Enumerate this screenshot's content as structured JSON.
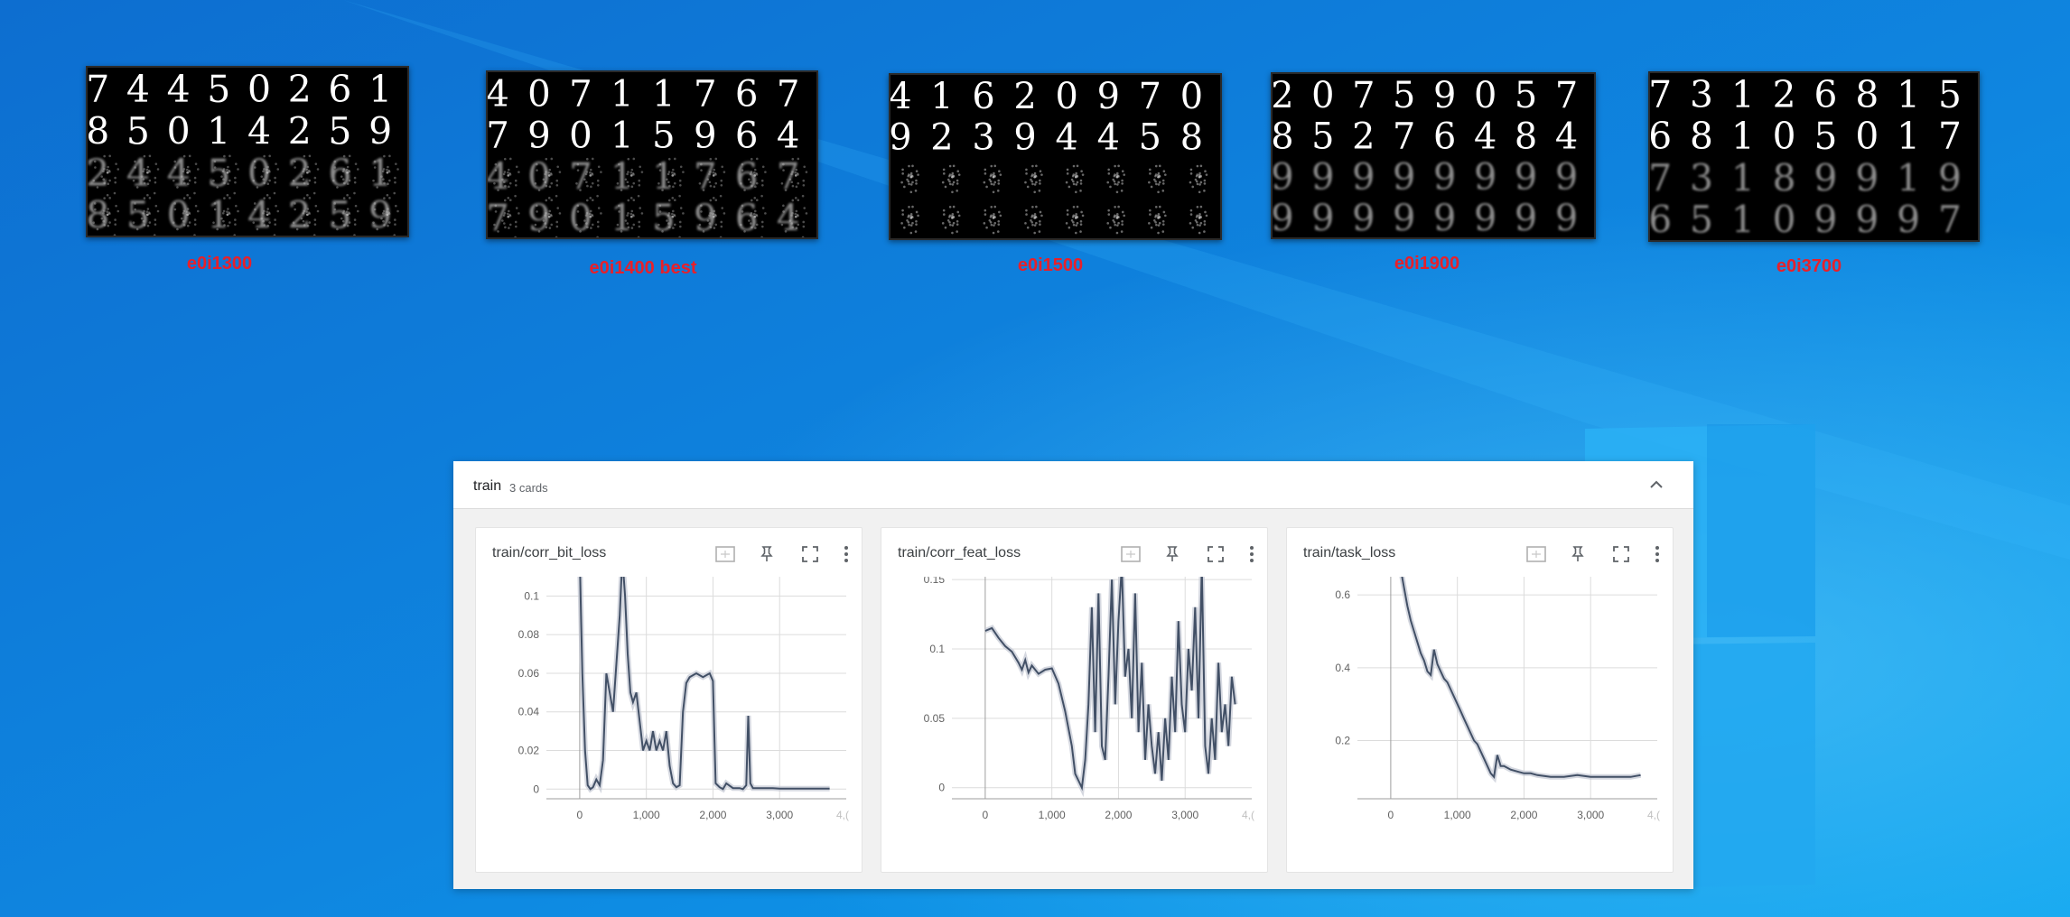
{
  "desktop": {
    "wallpaper": "windows-10-blue-light",
    "colors": {
      "bg_dark": "#0a5fb8",
      "bg_mid": "#1188e2",
      "bg_light": "#35b6f4",
      "logo": "#3fc2ff"
    }
  },
  "snapshots": [
    {
      "caption": "e0i1300",
      "rows": [
        "74450261",
        "85014259",
        "24450261",
        "85014259"
      ],
      "row_quality": [
        "sharp",
        "sharp",
        "noisy",
        "noisy"
      ]
    },
    {
      "caption": "e0i1400 best",
      "rows": [
        "40711767",
        "79015964",
        "40711767",
        "79015964"
      ],
      "row_quality": [
        "sharp",
        "sharp",
        "noisy",
        "noisy"
      ]
    },
    {
      "caption": "e0i1500",
      "rows": [
        "41620970",
        "92394458",
        "",
        ""
      ],
      "row_quality": [
        "sharp",
        "sharp",
        "blob",
        "blob"
      ]
    },
    {
      "caption": "e0i1900",
      "rows": [
        "20759057",
        "85276484",
        "99999999",
        "99999999"
      ],
      "row_quality": [
        "sharp",
        "sharp",
        "blurry",
        "blurry"
      ]
    },
    {
      "caption": "e0i3700",
      "rows": [
        "73126815",
        "68105017",
        "73189919",
        "65109997"
      ],
      "row_quality": [
        "sharp",
        "sharp",
        "blurry",
        "blurry"
      ]
    }
  ],
  "tensorboard": {
    "group_name": "train",
    "card_count": "3 cards",
    "colors": {
      "line": "#425066",
      "line_raw": "#c3c8d3",
      "grid": "#dcdcdc",
      "axis_text": "#616161"
    },
    "icons": [
      "fit-domain-icon",
      "pin-icon",
      "fullscreen-icon",
      "more-vert-icon"
    ]
  },
  "chart_data": [
    {
      "type": "line",
      "title": "train/corr_bit_loss",
      "xlim": [
        -500,
        4000
      ],
      "ylim": [
        -0.005,
        0.11
      ],
      "x_ticks": [
        0,
        1000,
        2000,
        3000
      ],
      "x_tick_labels": [
        "0",
        "1,000",
        "2,000",
        "3,000",
        "4,("
      ],
      "y_ticks": [
        0,
        0.02,
        0.04,
        0.06,
        0.08,
        0.1
      ],
      "y_tick_labels": [
        "0",
        "0.02",
        "0.04",
        "0.06",
        "0.08",
        "0.1"
      ],
      "grid": true,
      "series": [
        {
          "x": [
            0,
            40,
            80,
            120,
            160,
            200,
            250,
            300,
            350,
            400,
            450,
            500,
            550,
            600,
            640,
            680,
            720,
            760,
            800,
            850,
            900,
            950,
            1000,
            1050,
            1100,
            1150,
            1200,
            1250,
            1300,
            1350,
            1400,
            1450,
            1500,
            1550,
            1600,
            1650,
            1700,
            1750,
            1800,
            1850,
            1900,
            1950,
            2000,
            2040,
            2100,
            2150,
            2200,
            2300,
            2400,
            2450,
            2500,
            2530,
            2560,
            2600,
            2700,
            2800,
            2900,
            3000,
            3200,
            3400,
            3600,
            3750
          ],
          "y": [
            0.12,
            0.06,
            0.02,
            0.002,
            0.0,
            0.001,
            0.005,
            0.002,
            0.015,
            0.06,
            0.05,
            0.04,
            0.065,
            0.09,
            0.12,
            0.1,
            0.07,
            0.05,
            0.045,
            0.05,
            0.035,
            0.02,
            0.025,
            0.02,
            0.03,
            0.02,
            0.025,
            0.02,
            0.03,
            0.012,
            0.003,
            0.001,
            0.002,
            0.04,
            0.055,
            0.058,
            0.059,
            0.06,
            0.059,
            0.058,
            0.059,
            0.06,
            0.056,
            0.003,
            0.001,
            0.0,
            0.003,
            0.0005,
            0.0005,
            0.0,
            0.002,
            0.038,
            0.003,
            0.0005,
            0.0005,
            0.0005,
            0.0005,
            0.0003,
            0.0003,
            0.0003,
            0.0003,
            0.0003
          ]
        }
      ]
    },
    {
      "type": "line",
      "title": "train/corr_feat_loss",
      "xlim": [
        -500,
        4000
      ],
      "ylim": [
        -0.008,
        0.152
      ],
      "x_ticks": [
        0,
        1000,
        2000,
        3000
      ],
      "x_tick_labels": [
        "0",
        "1,000",
        "2,000",
        "3,000",
        "4,("
      ],
      "y_ticks": [
        0,
        0.05,
        0.1,
        0.15
      ],
      "y_tick_labels": [
        "0",
        "0.05",
        "0.1",
        "0.15"
      ],
      "grid": true,
      "series": [
        {
          "x": [
            0,
            100,
            200,
            300,
            400,
            500,
            550,
            600,
            650,
            700,
            800,
            900,
            1000,
            1100,
            1200,
            1300,
            1350,
            1400,
            1450,
            1500,
            1550,
            1600,
            1650,
            1700,
            1750,
            1800,
            1850,
            1900,
            1950,
            2000,
            2050,
            2100,
            2150,
            2200,
            2250,
            2300,
            2350,
            2400,
            2450,
            2500,
            2550,
            2600,
            2650,
            2700,
            2750,
            2800,
            2850,
            2900,
            2950,
            3000,
            3050,
            3100,
            3150,
            3200,
            3250,
            3300,
            3350,
            3400,
            3450,
            3500,
            3550,
            3600,
            3650,
            3700,
            3750
          ],
          "y": [
            0.113,
            0.115,
            0.108,
            0.102,
            0.098,
            0.09,
            0.085,
            0.092,
            0.083,
            0.088,
            0.082,
            0.085,
            0.086,
            0.075,
            0.055,
            0.03,
            0.01,
            0.005,
            0.0,
            0.02,
            0.06,
            0.13,
            0.04,
            0.14,
            0.03,
            0.02,
            0.08,
            0.15,
            0.06,
            0.12,
            0.16,
            0.08,
            0.1,
            0.05,
            0.14,
            0.04,
            0.09,
            0.02,
            0.06,
            0.03,
            0.01,
            0.04,
            0.005,
            0.05,
            0.02,
            0.08,
            0.04,
            0.12,
            0.06,
            0.04,
            0.1,
            0.07,
            0.13,
            0.05,
            0.16,
            0.03,
            0.01,
            0.05,
            0.02,
            0.09,
            0.04,
            0.06,
            0.03,
            0.08,
            0.06
          ]
        }
      ]
    },
    {
      "type": "line",
      "title": "train/task_loss",
      "xlim": [
        -500,
        4000
      ],
      "ylim": [
        0.04,
        0.65
      ],
      "x_ticks": [
        0,
        1000,
        2000,
        3000
      ],
      "x_tick_labels": [
        "0",
        "1,000",
        "2,000",
        "3,000",
        "4,("
      ],
      "y_ticks": [
        0.2,
        0.4,
        0.6
      ],
      "y_tick_labels": [
        "0.2",
        "0.4",
        "0.6"
      ],
      "grid": true,
      "series": [
        {
          "x": [
            150,
            200,
            250,
            300,
            350,
            400,
            450,
            500,
            550,
            600,
            650,
            700,
            750,
            800,
            850,
            900,
            950,
            1000,
            1050,
            1100,
            1150,
            1200,
            1250,
            1300,
            1350,
            1400,
            1450,
            1500,
            1550,
            1600,
            1650,
            1700,
            1800,
            1900,
            2000,
            2100,
            2200,
            2400,
            2600,
            2800,
            3000,
            3200,
            3400,
            3600,
            3750
          ],
          "y": [
            0.67,
            0.62,
            0.57,
            0.53,
            0.5,
            0.47,
            0.44,
            0.42,
            0.39,
            0.38,
            0.45,
            0.41,
            0.39,
            0.37,
            0.36,
            0.34,
            0.32,
            0.3,
            0.28,
            0.26,
            0.24,
            0.22,
            0.2,
            0.19,
            0.17,
            0.15,
            0.13,
            0.11,
            0.1,
            0.16,
            0.13,
            0.13,
            0.12,
            0.115,
            0.11,
            0.11,
            0.105,
            0.1,
            0.1,
            0.105,
            0.1,
            0.1,
            0.1,
            0.1,
            0.105
          ]
        }
      ]
    }
  ]
}
